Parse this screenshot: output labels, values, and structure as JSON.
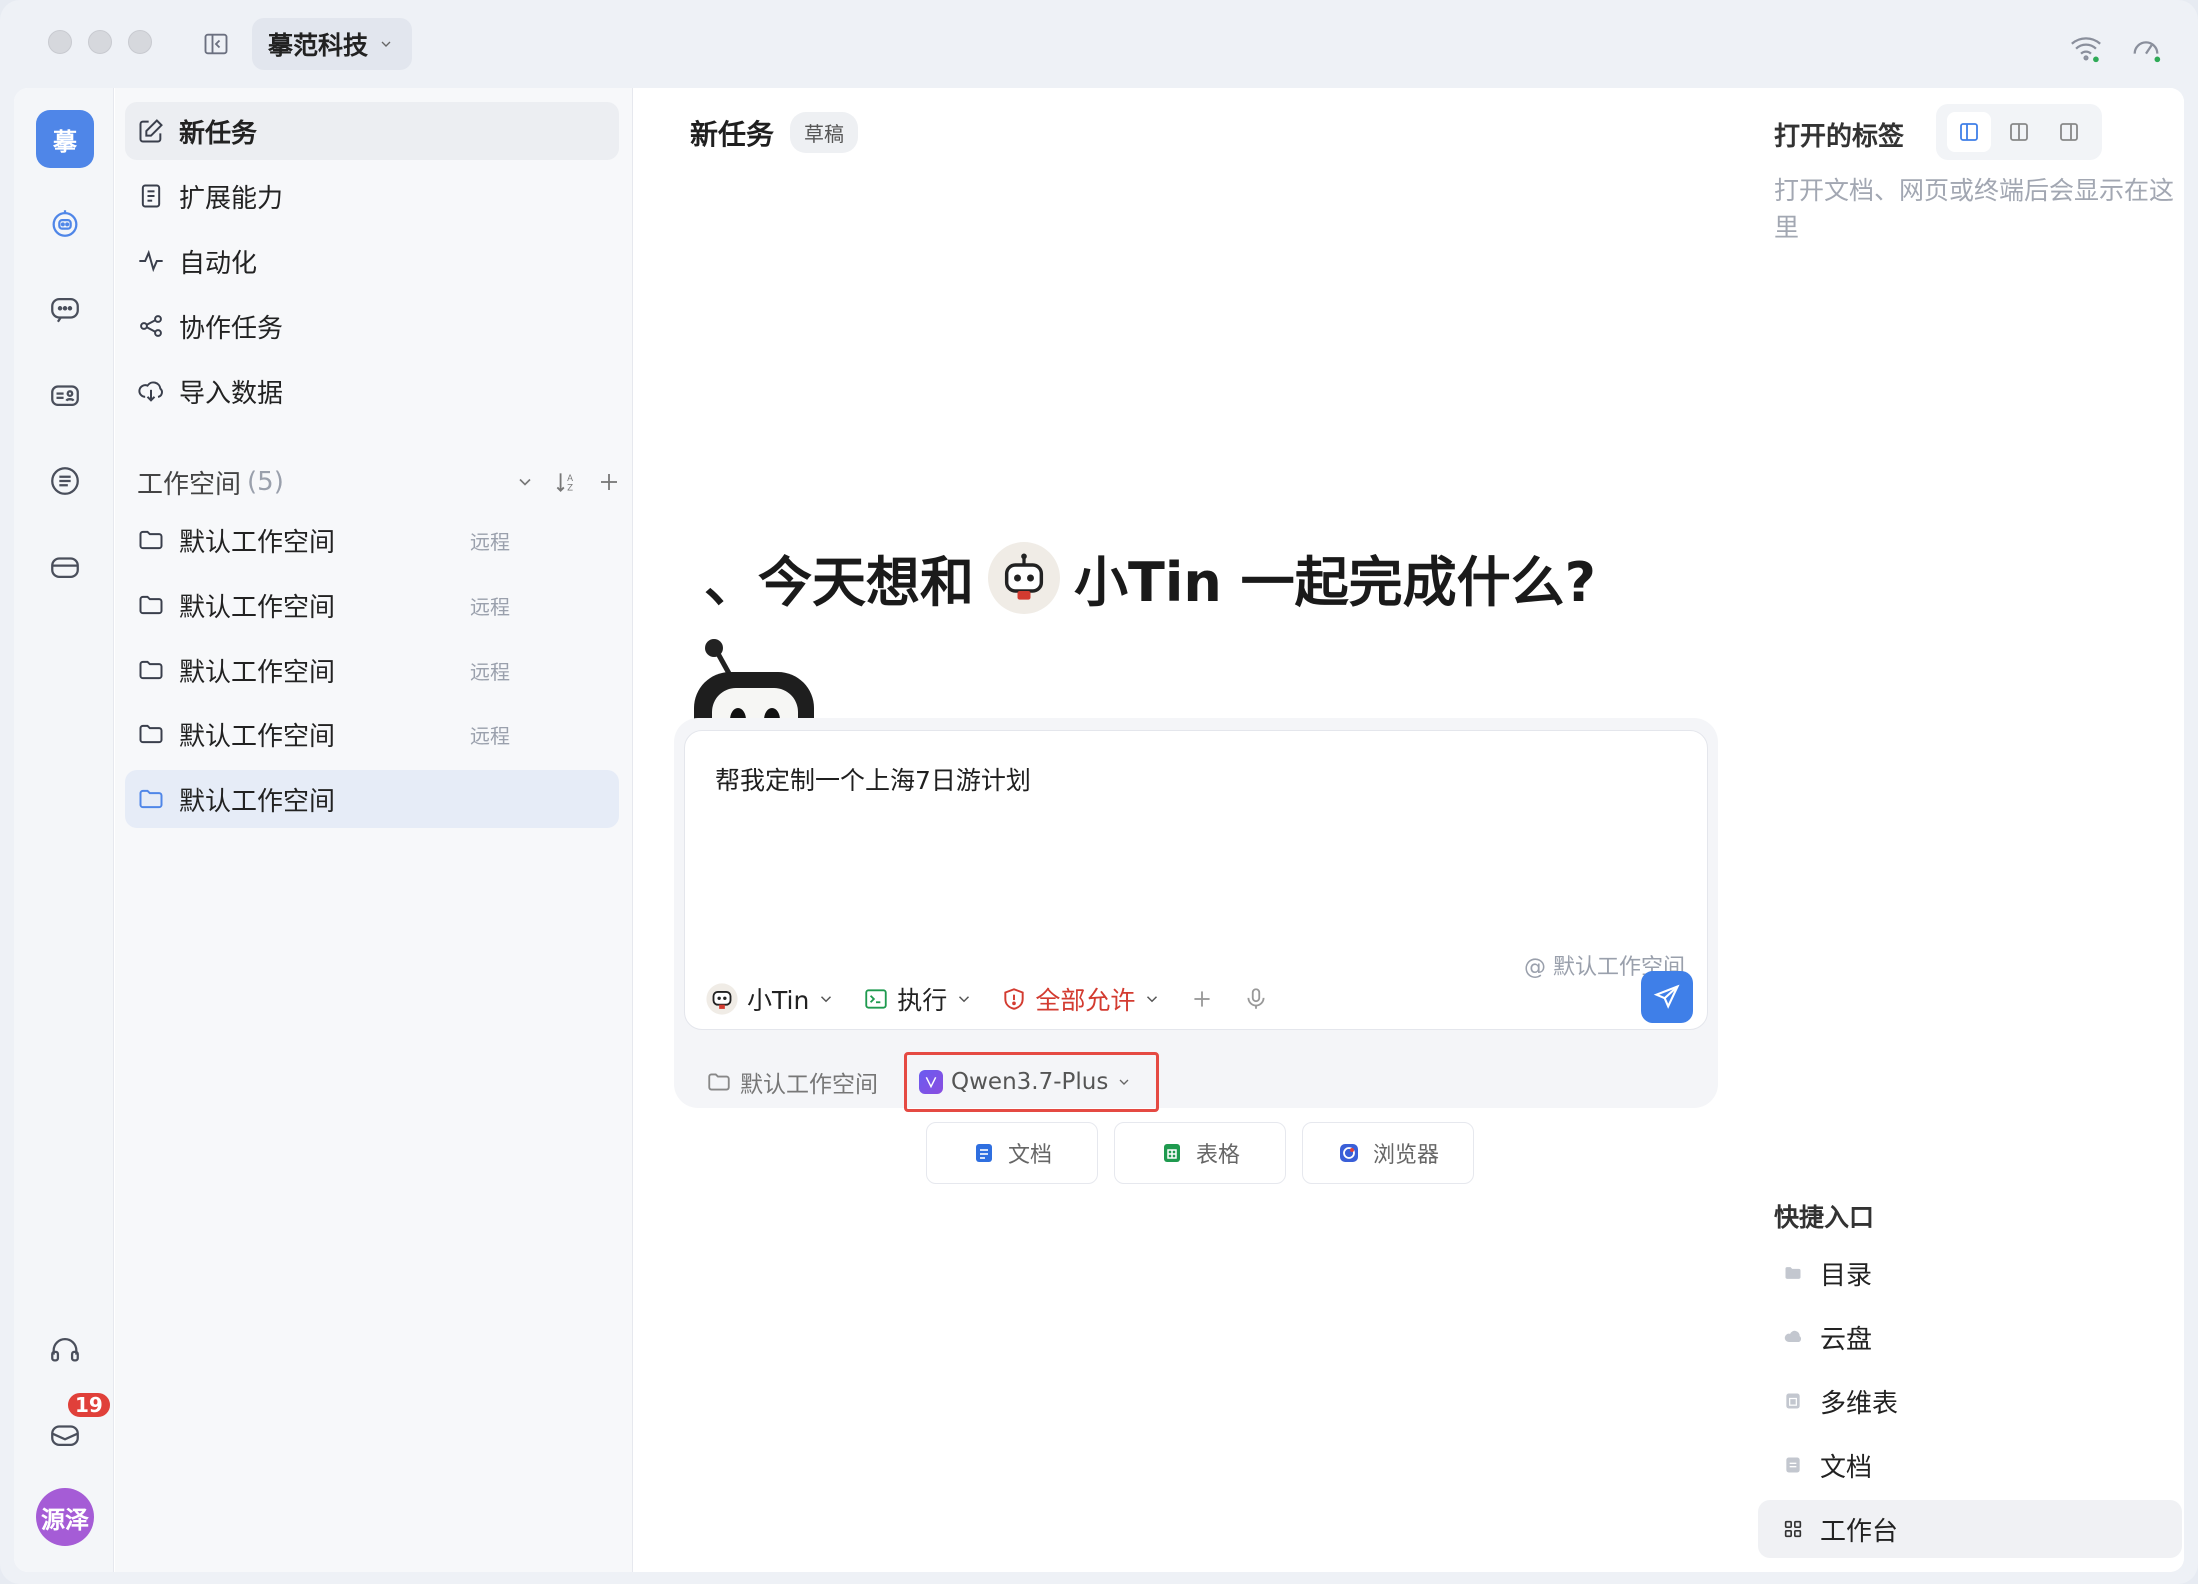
{
  "titlebar": {
    "org_name": "摹范科技"
  },
  "rail": {
    "logo_text": "摹",
    "badge_count": "19",
    "avatar_text": "源泽"
  },
  "sidebar": {
    "nav": [
      {
        "label": "新任务"
      },
      {
        "label": "扩展能力"
      },
      {
        "label": "自动化"
      },
      {
        "label": "协作任务"
      },
      {
        "label": "导入数据"
      }
    ],
    "workspace_header": "工作空间",
    "workspace_count": "(5)",
    "workspaces": [
      {
        "label": "默认工作空间",
        "tag": "远程"
      },
      {
        "label": "默认工作空间",
        "tag": "远程"
      },
      {
        "label": "默认工作空间",
        "tag": "远程"
      },
      {
        "label": "默认工作空间",
        "tag": "远程"
      },
      {
        "label": "默认工作空间",
        "tag": ""
      }
    ]
  },
  "main": {
    "title": "新任务",
    "draft_badge": "草稿",
    "hero_prefix": "、今天想和",
    "hero_suffix": "小Tin 一起完成什么?",
    "prompt_text": "帮我定制一个上海7日游计划",
    "at_workspace": "@ 默认工作空间",
    "agent_label": "小Tin",
    "mode_label": "执行",
    "permission_label": "全部允许",
    "footer_workspace": "默认工作空间",
    "model_label": "Qwen3.7-Plus",
    "chips": [
      {
        "label": "文档",
        "color": "#2f6fe0"
      },
      {
        "label": "表格",
        "color": "#1f9a4f"
      },
      {
        "label": "浏览器",
        "color": "#3a5fd8"
      }
    ]
  },
  "right_panel": {
    "title": "打开的标签",
    "empty_text": "打开文档、网页或终端后会显示在这里",
    "quick_title": "快捷入口",
    "quick_items": [
      {
        "label": "目录"
      },
      {
        "label": "云盘"
      },
      {
        "label": "多维表"
      },
      {
        "label": "文档"
      },
      {
        "label": "工作台"
      }
    ]
  },
  "colors": {
    "accent": "#3f7fe8",
    "danger": "#d33b30",
    "highlight_box": "#e54a43"
  }
}
